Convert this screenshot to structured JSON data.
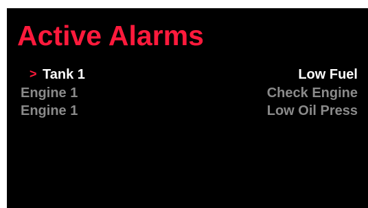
{
  "title": "Active Alarms",
  "selector_glyph": ">",
  "colors": {
    "background": "#000000",
    "accent": "#ff1a3c",
    "selected_text": "#ffffff",
    "inactive_text": "#8a8a8a"
  },
  "alarms": [
    {
      "source": "Tank 1",
      "message": "Low Fuel",
      "selected": true
    },
    {
      "source": "Engine 1",
      "message": "Check Engine",
      "selected": false
    },
    {
      "source": "Engine 1",
      "message": "Low Oil Press",
      "selected": false
    }
  ]
}
